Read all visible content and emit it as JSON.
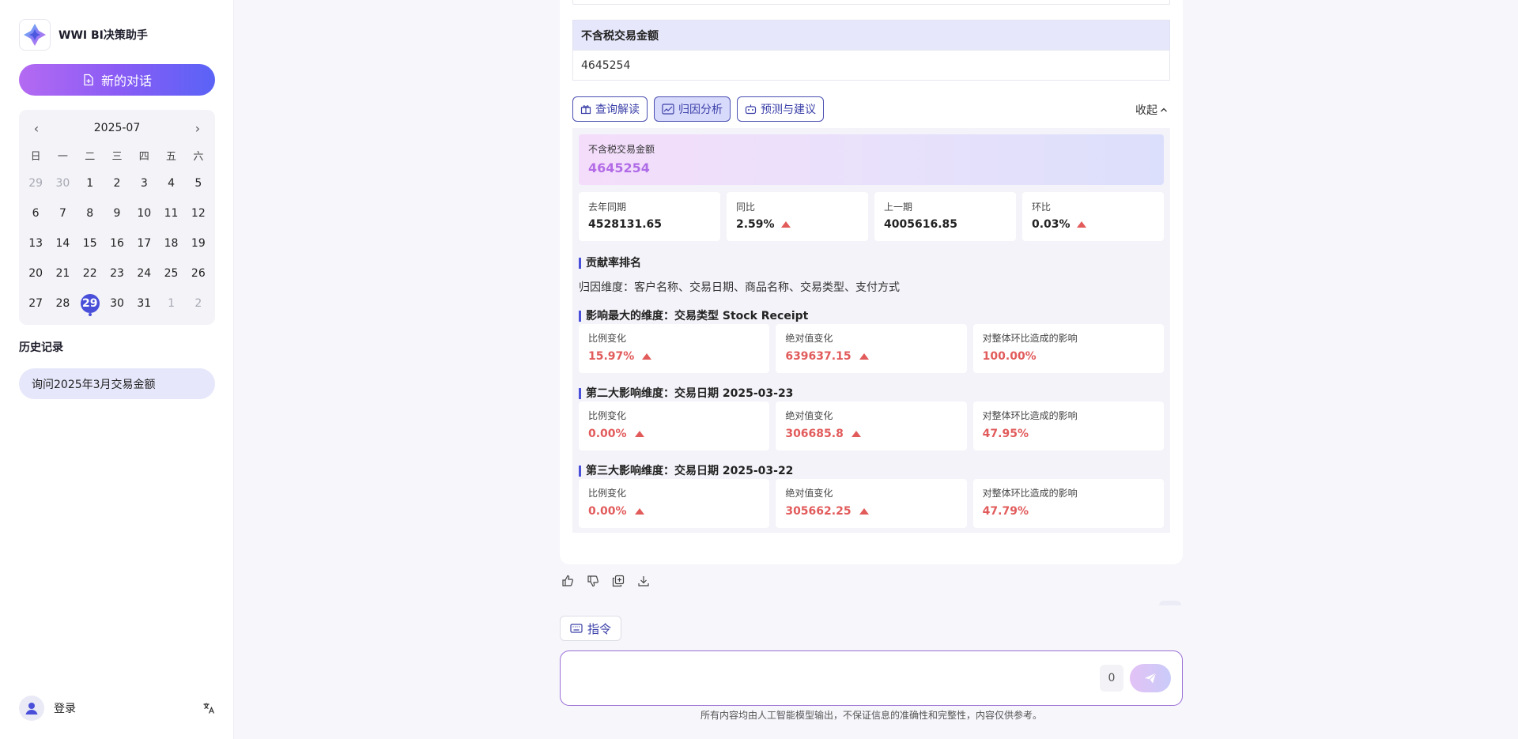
{
  "app": {
    "name": "WWI BI决策助手",
    "new_chat_label": "新的对话"
  },
  "calendar": {
    "title": "2025-07",
    "weekdays": [
      "日",
      "一",
      "二",
      "三",
      "四",
      "五",
      "六"
    ],
    "days": [
      {
        "d": "29",
        "muted": true
      },
      {
        "d": "30",
        "muted": true
      },
      {
        "d": "1"
      },
      {
        "d": "2"
      },
      {
        "d": "3"
      },
      {
        "d": "4"
      },
      {
        "d": "5"
      },
      {
        "d": "6"
      },
      {
        "d": "7"
      },
      {
        "d": "8"
      },
      {
        "d": "9"
      },
      {
        "d": "10"
      },
      {
        "d": "11"
      },
      {
        "d": "12"
      },
      {
        "d": "13"
      },
      {
        "d": "14"
      },
      {
        "d": "15"
      },
      {
        "d": "16"
      },
      {
        "d": "17"
      },
      {
        "d": "18"
      },
      {
        "d": "19"
      },
      {
        "d": "20"
      },
      {
        "d": "21"
      },
      {
        "d": "22"
      },
      {
        "d": "23"
      },
      {
        "d": "24"
      },
      {
        "d": "25"
      },
      {
        "d": "26"
      },
      {
        "d": "27"
      },
      {
        "d": "28"
      },
      {
        "d": "29",
        "today": true
      },
      {
        "d": "30"
      },
      {
        "d": "31"
      },
      {
        "d": "1",
        "muted": true
      },
      {
        "d": "2",
        "muted": true
      }
    ]
  },
  "history": {
    "title": "历史记录",
    "items": [
      "询问2025年3月交易金额"
    ]
  },
  "user": {
    "login_label": "登录"
  },
  "result_table": {
    "header": "不含税交易金额",
    "value": "4645254"
  },
  "tabs": [
    "查询解读",
    "归因分析",
    "预测与建议"
  ],
  "active_tab": 1,
  "collapse_label": "收起",
  "analysis": {
    "hero": {
      "label": "不含税交易金额",
      "value": "4645254"
    },
    "kpis": [
      {
        "label": "去年同期",
        "value": "4528131.65",
        "up": false
      },
      {
        "label": "同比",
        "value": "2.59%",
        "up": true
      },
      {
        "label": "上一期",
        "value": "4005616.85",
        "up": false
      },
      {
        "label": "环比",
        "value": "0.03%",
        "up": true
      }
    ],
    "ranking_title": "贡献率排名",
    "dimensions_text": "归因维度：客户名称、交易日期、商品名称、交易类型、支付方式",
    "impacts": [
      {
        "title": "影响最大的维度：交易类型 Stock Receipt",
        "cells": [
          {
            "label": "比例变化",
            "value": "15.97%",
            "up": true
          },
          {
            "label": "绝对值变化",
            "value": "639637.15",
            "up": true
          },
          {
            "label": "对整体环比造成的影响",
            "value": "100.00%",
            "up": false
          }
        ]
      },
      {
        "title": "第二大影响维度：交易日期 2025-03-23",
        "cells": [
          {
            "label": "比例变化",
            "value": "0.00%",
            "up": true
          },
          {
            "label": "绝对值变化",
            "value": "306685.8",
            "up": true
          },
          {
            "label": "对整体环比造成的影响",
            "value": "47.95%",
            "up": false
          }
        ]
      },
      {
        "title": "第三大影响维度：交易日期 2025-03-22",
        "cells": [
          {
            "label": "比例变化",
            "value": "0.00%",
            "up": true
          },
          {
            "label": "绝对值变化",
            "value": "305662.25",
            "up": true
          },
          {
            "label": "对整体环比造成的影响",
            "value": "47.79%",
            "up": false
          }
        ]
      }
    ]
  },
  "composer": {
    "command_label": "指令",
    "value": "",
    "char_count": "0",
    "disclaimer": "所有内容均由人工智能模型输出，不保证信息的准确性和完整性，内容仅供参考。"
  },
  "colors": {
    "accent": "#4a4fd9",
    "up_red": "#e25b5b",
    "tab_active_bg": "#d8dafb"
  }
}
